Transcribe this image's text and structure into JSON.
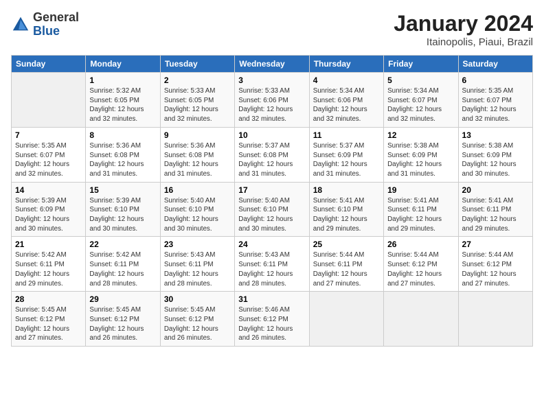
{
  "header": {
    "logo_general": "General",
    "logo_blue": "Blue",
    "main_title": "January 2024",
    "sub_title": "Itainopolis, Piaui, Brazil"
  },
  "days_of_week": [
    "Sunday",
    "Monday",
    "Tuesday",
    "Wednesday",
    "Thursday",
    "Friday",
    "Saturday"
  ],
  "weeks": [
    [
      {
        "day": "",
        "sunrise": "",
        "sunset": "",
        "daylight": ""
      },
      {
        "day": "1",
        "sunrise": "Sunrise: 5:32 AM",
        "sunset": "Sunset: 6:05 PM",
        "daylight": "Daylight: 12 hours and 32 minutes."
      },
      {
        "day": "2",
        "sunrise": "Sunrise: 5:33 AM",
        "sunset": "Sunset: 6:05 PM",
        "daylight": "Daylight: 12 hours and 32 minutes."
      },
      {
        "day": "3",
        "sunrise": "Sunrise: 5:33 AM",
        "sunset": "Sunset: 6:06 PM",
        "daylight": "Daylight: 12 hours and 32 minutes."
      },
      {
        "day": "4",
        "sunrise": "Sunrise: 5:34 AM",
        "sunset": "Sunset: 6:06 PM",
        "daylight": "Daylight: 12 hours and 32 minutes."
      },
      {
        "day": "5",
        "sunrise": "Sunrise: 5:34 AM",
        "sunset": "Sunset: 6:07 PM",
        "daylight": "Daylight: 12 hours and 32 minutes."
      },
      {
        "day": "6",
        "sunrise": "Sunrise: 5:35 AM",
        "sunset": "Sunset: 6:07 PM",
        "daylight": "Daylight: 12 hours and 32 minutes."
      }
    ],
    [
      {
        "day": "7",
        "sunrise": "Sunrise: 5:35 AM",
        "sunset": "Sunset: 6:07 PM",
        "daylight": "Daylight: 12 hours and 32 minutes."
      },
      {
        "day": "8",
        "sunrise": "Sunrise: 5:36 AM",
        "sunset": "Sunset: 6:08 PM",
        "daylight": "Daylight: 12 hours and 31 minutes."
      },
      {
        "day": "9",
        "sunrise": "Sunrise: 5:36 AM",
        "sunset": "Sunset: 6:08 PM",
        "daylight": "Daylight: 12 hours and 31 minutes."
      },
      {
        "day": "10",
        "sunrise": "Sunrise: 5:37 AM",
        "sunset": "Sunset: 6:08 PM",
        "daylight": "Daylight: 12 hours and 31 minutes."
      },
      {
        "day": "11",
        "sunrise": "Sunrise: 5:37 AM",
        "sunset": "Sunset: 6:09 PM",
        "daylight": "Daylight: 12 hours and 31 minutes."
      },
      {
        "day": "12",
        "sunrise": "Sunrise: 5:38 AM",
        "sunset": "Sunset: 6:09 PM",
        "daylight": "Daylight: 12 hours and 31 minutes."
      },
      {
        "day": "13",
        "sunrise": "Sunrise: 5:38 AM",
        "sunset": "Sunset: 6:09 PM",
        "daylight": "Daylight: 12 hours and 30 minutes."
      }
    ],
    [
      {
        "day": "14",
        "sunrise": "Sunrise: 5:39 AM",
        "sunset": "Sunset: 6:09 PM",
        "daylight": "Daylight: 12 hours and 30 minutes."
      },
      {
        "day": "15",
        "sunrise": "Sunrise: 5:39 AM",
        "sunset": "Sunset: 6:10 PM",
        "daylight": "Daylight: 12 hours and 30 minutes."
      },
      {
        "day": "16",
        "sunrise": "Sunrise: 5:40 AM",
        "sunset": "Sunset: 6:10 PM",
        "daylight": "Daylight: 12 hours and 30 minutes."
      },
      {
        "day": "17",
        "sunrise": "Sunrise: 5:40 AM",
        "sunset": "Sunset: 6:10 PM",
        "daylight": "Daylight: 12 hours and 30 minutes."
      },
      {
        "day": "18",
        "sunrise": "Sunrise: 5:41 AM",
        "sunset": "Sunset: 6:10 PM",
        "daylight": "Daylight: 12 hours and 29 minutes."
      },
      {
        "day": "19",
        "sunrise": "Sunrise: 5:41 AM",
        "sunset": "Sunset: 6:11 PM",
        "daylight": "Daylight: 12 hours and 29 minutes."
      },
      {
        "day": "20",
        "sunrise": "Sunrise: 5:41 AM",
        "sunset": "Sunset: 6:11 PM",
        "daylight": "Daylight: 12 hours and 29 minutes."
      }
    ],
    [
      {
        "day": "21",
        "sunrise": "Sunrise: 5:42 AM",
        "sunset": "Sunset: 6:11 PM",
        "daylight": "Daylight: 12 hours and 29 minutes."
      },
      {
        "day": "22",
        "sunrise": "Sunrise: 5:42 AM",
        "sunset": "Sunset: 6:11 PM",
        "daylight": "Daylight: 12 hours and 28 minutes."
      },
      {
        "day": "23",
        "sunrise": "Sunrise: 5:43 AM",
        "sunset": "Sunset: 6:11 PM",
        "daylight": "Daylight: 12 hours and 28 minutes."
      },
      {
        "day": "24",
        "sunrise": "Sunrise: 5:43 AM",
        "sunset": "Sunset: 6:11 PM",
        "daylight": "Daylight: 12 hours and 28 minutes."
      },
      {
        "day": "25",
        "sunrise": "Sunrise: 5:44 AM",
        "sunset": "Sunset: 6:11 PM",
        "daylight": "Daylight: 12 hours and 27 minutes."
      },
      {
        "day": "26",
        "sunrise": "Sunrise: 5:44 AM",
        "sunset": "Sunset: 6:12 PM",
        "daylight": "Daylight: 12 hours and 27 minutes."
      },
      {
        "day": "27",
        "sunrise": "Sunrise: 5:44 AM",
        "sunset": "Sunset: 6:12 PM",
        "daylight": "Daylight: 12 hours and 27 minutes."
      }
    ],
    [
      {
        "day": "28",
        "sunrise": "Sunrise: 5:45 AM",
        "sunset": "Sunset: 6:12 PM",
        "daylight": "Daylight: 12 hours and 27 minutes."
      },
      {
        "day": "29",
        "sunrise": "Sunrise: 5:45 AM",
        "sunset": "Sunset: 6:12 PM",
        "daylight": "Daylight: 12 hours and 26 minutes."
      },
      {
        "day": "30",
        "sunrise": "Sunrise: 5:45 AM",
        "sunset": "Sunset: 6:12 PM",
        "daylight": "Daylight: 12 hours and 26 minutes."
      },
      {
        "day": "31",
        "sunrise": "Sunrise: 5:46 AM",
        "sunset": "Sunset: 6:12 PM",
        "daylight": "Daylight: 12 hours and 26 minutes."
      },
      {
        "day": "",
        "sunrise": "",
        "sunset": "",
        "daylight": ""
      },
      {
        "day": "",
        "sunrise": "",
        "sunset": "",
        "daylight": ""
      },
      {
        "day": "",
        "sunrise": "",
        "sunset": "",
        "daylight": ""
      }
    ]
  ]
}
